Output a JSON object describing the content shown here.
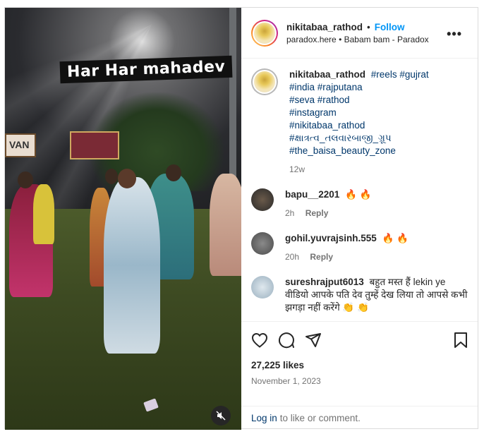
{
  "post": {
    "video_caption": "Har Har mahadev",
    "sign_text": "VAN",
    "author": "nikitabaa_rathod",
    "follow_label": "Follow",
    "location": "paradox.here",
    "audio": "Babam bam - Paradox",
    "caption_user": "nikitabaa_rathod",
    "caption_tags": [
      "#reels #gujrat",
      "#india #rajputana",
      "#seva #rathod",
      "#instagram",
      "#nikitabaa_rathod",
      "#ક્ષાત્રત્વ_તલવારબાજી_ગ્રૂપ",
      "#the_baisa_beauty_zone"
    ],
    "caption_age": "12w",
    "likes": "27,225 likes",
    "date": "November 1, 2023"
  },
  "comments": [
    {
      "user": "bapu__2201",
      "text": "🔥 🔥",
      "age": "2h",
      "reply": "Reply"
    },
    {
      "user": "gohil.yuvrajsinh.555",
      "text": "🔥 🔥",
      "age": "20h",
      "reply": "Reply"
    },
    {
      "user": "sureshrajput6013",
      "text": "बहुत मस्त हैं lekin ye वीडियो आपके पति देव तुम्हें देख लिया तो आपसे कभी झगड़ा नहीं करेंगे 👏 👏"
    }
  ],
  "footer": {
    "login_link": "Log in",
    "login_text": "to like or comment."
  },
  "icons": [
    "more-options-icon",
    "mute-icon",
    "heart-icon",
    "comment-icon",
    "share-icon",
    "save-icon"
  ],
  "colors": {
    "link": "#00376b",
    "follow": "#0095f6",
    "muted": "#737373"
  }
}
